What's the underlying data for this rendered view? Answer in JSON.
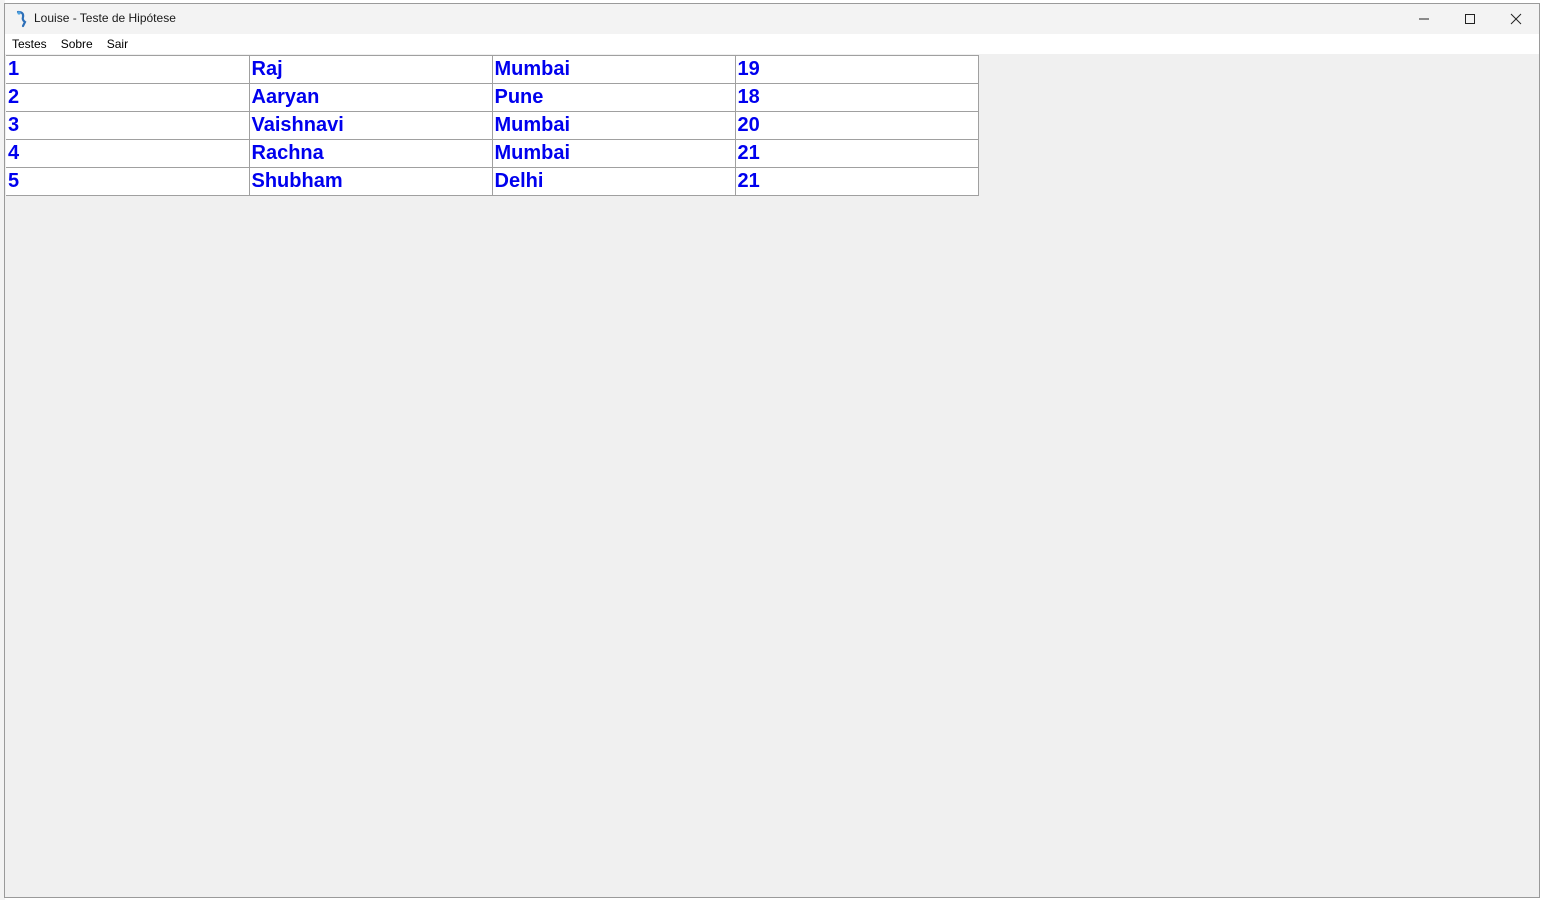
{
  "window": {
    "title": "Louise - Teste de Hipótese",
    "controls": [
      "minimize-icon",
      "maximize-icon",
      "close-icon"
    ]
  },
  "menu": {
    "items": [
      "Testes",
      "Sobre",
      "Sair"
    ]
  },
  "table": {
    "text_color": "#0000ee",
    "rows": [
      [
        "1",
        "Raj",
        "Mumbai",
        "19"
      ],
      [
        "2",
        "Aaryan",
        "Pune",
        "18"
      ],
      [
        "3",
        "Vaishnavi",
        "Mumbai",
        "20"
      ],
      [
        "4",
        "Rachna",
        "Mumbai",
        "21"
      ],
      [
        "5",
        "Shubham",
        "Delhi",
        "21"
      ]
    ]
  }
}
